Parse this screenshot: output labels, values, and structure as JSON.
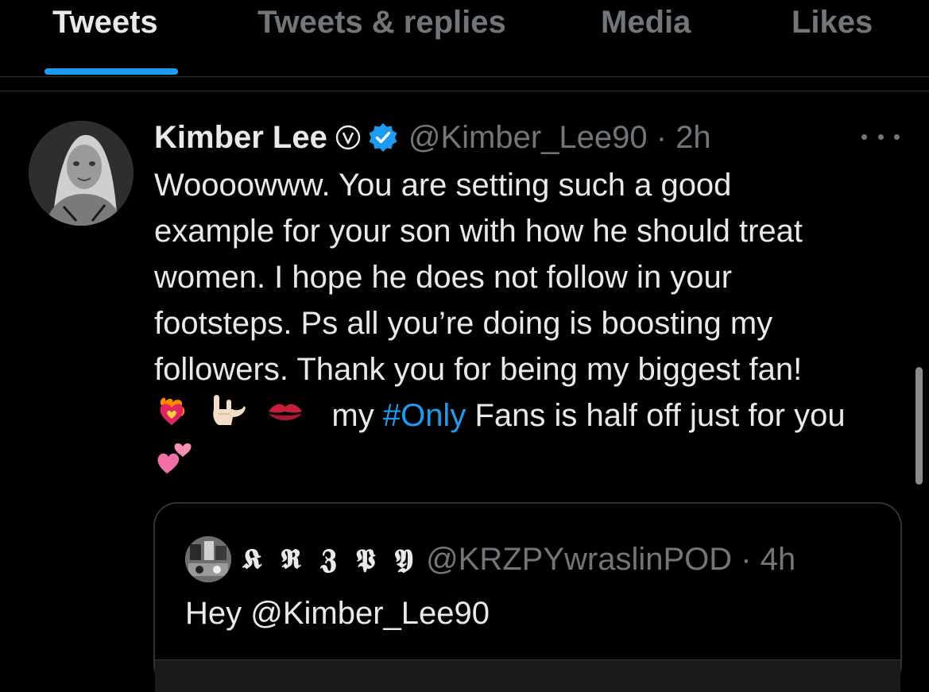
{
  "tabs": [
    {
      "label": "Tweets",
      "active": true
    },
    {
      "label": "Tweets & replies",
      "active": false
    },
    {
      "label": "Media",
      "active": false
    },
    {
      "label": "Likes",
      "active": false
    }
  ],
  "accent_color": "#1d9bf0",
  "tweet": {
    "author_name": "Kimber Lee",
    "badges": [
      "v-circle-icon",
      "verified-check-icon"
    ],
    "handle_time": "@Kimber_Lee90 · 2h",
    "more_icon": "more-dots-icon",
    "lines": [
      "Woooowww. You are setting such a good",
      "example for your son with how he should treat",
      "women. I hope he does not follow in your",
      "footsteps. Ps all you’re doing is boosting my",
      "followers. Thank you for being my biggest fan!"
    ],
    "emoji_line": {
      "emojis": [
        "heart-on-fire-emoji",
        "love-you-gesture-emoji",
        "kiss-mark-emoji"
      ],
      "text_before": "my",
      "hashtag": "#Only",
      "text_after": "Fans is half off just for you"
    },
    "last_emoji": "two-hearts-emoji"
  },
  "quoted_tweet": {
    "author_name": "𝕶 𝕽 𝖅 𝕻 𝖄",
    "handle_time": "@KRZPYwraslinPOD · 4h",
    "text": "Hey @Kimber_Lee90"
  }
}
